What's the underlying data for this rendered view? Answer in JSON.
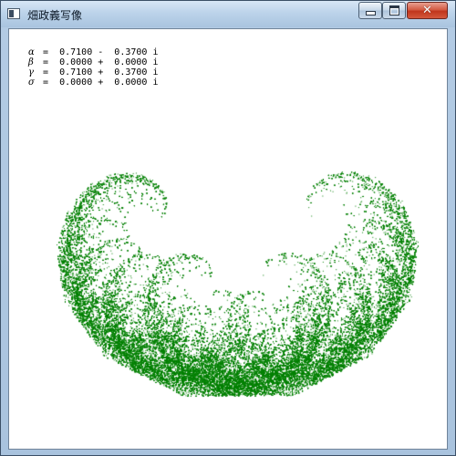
{
  "window": {
    "title": "畑政義写像",
    "controls": {
      "minimize": "minimize",
      "maximize": "maximize",
      "close": "✕"
    }
  },
  "parameters": [
    {
      "symbol": "α",
      "text": "=  0.7100 -  0.3700 i"
    },
    {
      "symbol": "β",
      "text": "=  0.0000 +  0.0000 i"
    },
    {
      "symbol": "γ",
      "text": "=  0.7100 +  0.3700 i"
    },
    {
      "symbol": "σ",
      "text": "=  0.0000 +  0.0000 i"
    }
  ],
  "fractal": {
    "name": "Hata map",
    "point_color": "#008000",
    "alpha": {
      "re": 0.71,
      "im": -0.37
    },
    "beta": {
      "re": 0.0,
      "im": 0.0
    },
    "gamma": {
      "re": 0.71,
      "im": 0.37
    },
    "sigma": {
      "re": 0.0,
      "im": 0.0
    }
  },
  "colors": {
    "title_bar": "#bcd3ea",
    "close_button": "#c0351c",
    "client_bg": "#ffffff"
  }
}
